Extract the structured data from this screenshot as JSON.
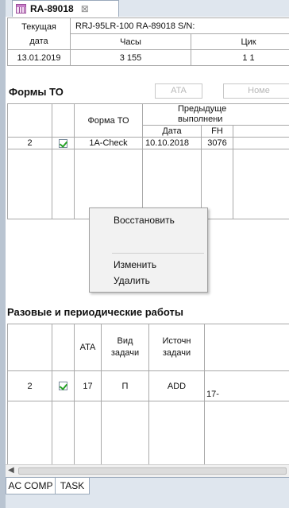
{
  "tab": {
    "title": "RA-89018",
    "close": "⊠"
  },
  "info": {
    "h_date1": "Текущая",
    "h_date2": "дата",
    "h_aircraft": "RRJ-95LR-100  RA-89018  S/N:",
    "h_hours": "Часы",
    "h_cycles": "Цик",
    "date": "13.01.2019",
    "hours": "3 155",
    "cycles": "1 1"
  },
  "forms": {
    "title": "Формы ТО",
    "filter_ata": "ATA",
    "filter_num": "Номе",
    "col_form": "Форма ТО",
    "col_prev1": "Предыдуще",
    "col_prev2": "выполнени",
    "col_date": "Дата",
    "col_fh": "FH",
    "rows": [
      {
        "num": "2",
        "form": "1A-Check",
        "date": "10.10.2018",
        "fh": "3076"
      }
    ]
  },
  "context_menu": {
    "items": [
      "Восстановить",
      "Изменить",
      "Удалить"
    ]
  },
  "periodic": {
    "title": "Разовые и периодические работы",
    "col_ata": "ATA",
    "col_type1": "Вид",
    "col_type2": "задачи",
    "col_src1": "Источн",
    "col_src2": "задачи",
    "rows": [
      {
        "num": "2",
        "ata": "17",
        "type": "П",
        "source": "ADD",
        "ref": "17-"
      }
    ]
  },
  "bottom_tabs": [
    "AC COMP",
    "TASK"
  ]
}
